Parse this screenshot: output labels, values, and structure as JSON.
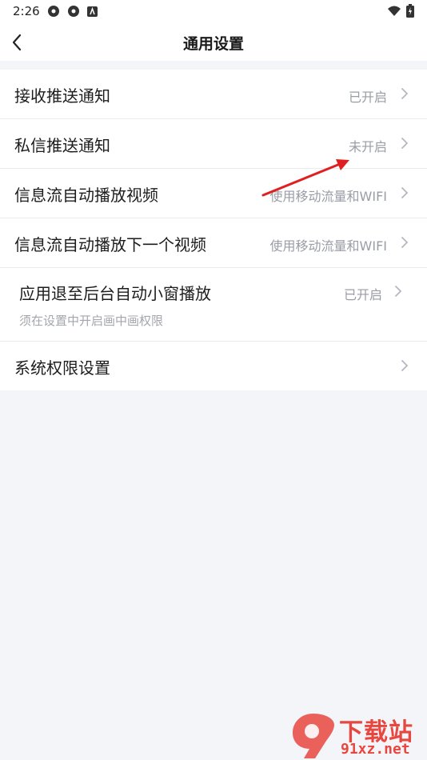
{
  "status_bar": {
    "time": "2:26"
  },
  "header": {
    "title": "通用设置"
  },
  "settings": [
    {
      "label": "接收推送通知",
      "value": "已开启"
    },
    {
      "label": "私信推送通知",
      "value": "未开启"
    },
    {
      "label": "信息流自动播放视频",
      "value": "使用移动流量和WIFI"
    },
    {
      "label": "信息流自动播放下一个视频",
      "value": "使用移动流量和WIFI"
    },
    {
      "label": "应用退至后台自动小窗播放",
      "value": "已开启",
      "subtitle": "须在设置中开启画中画权限"
    },
    {
      "label": "系统权限设置",
      "value": ""
    }
  ],
  "watermark": {
    "top": "下载站",
    "bottom": "91xz.net"
  },
  "colors": {
    "annotation": "#e02020",
    "watermark": "#e8473f"
  }
}
